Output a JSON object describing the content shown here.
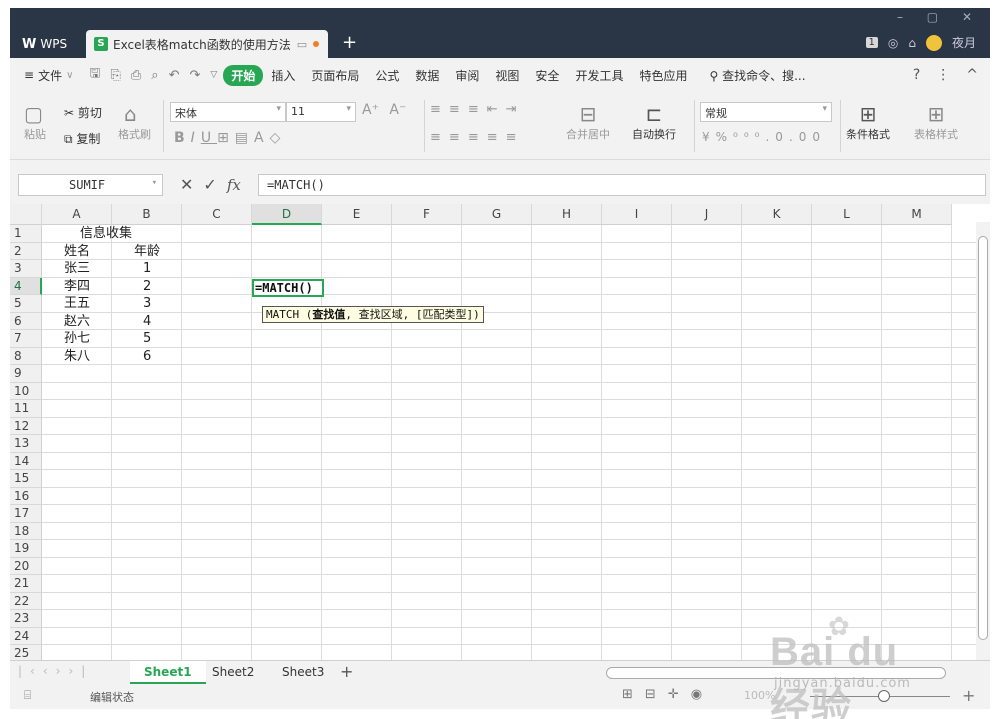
{
  "titlebar": {
    "wps_label": "WPS",
    "doc_tab": "Excel表格match函数的使用方法",
    "new_tab": "+",
    "win_min": "–",
    "win_max": "▢",
    "win_close": "✕",
    "badge": "1",
    "user": "夜月"
  },
  "menubar": {
    "file": "文件",
    "items": [
      "开始",
      "插入",
      "页面布局",
      "公式",
      "数据",
      "审阅",
      "视图",
      "安全",
      "开发工具",
      "特色应用"
    ],
    "search": "查找命令、搜...",
    "help": "?",
    "more": "⋮",
    "collapse": "^"
  },
  "ribbon": {
    "paste": "粘贴",
    "cut": "剪切",
    "copy": "复制",
    "format_painter": "格式刷",
    "font_name": "宋体",
    "font_size": "11",
    "merge_center": "合并居中",
    "wrap_text": "自动换行",
    "number_format": "常规",
    "conditional_format": "条件格式",
    "table_style": "表格样式"
  },
  "formulabar": {
    "namebox": "SUMIF",
    "fx": "fx",
    "formula": "=MATCH()"
  },
  "grid": {
    "columns": [
      "A",
      "B",
      "C",
      "D",
      "E",
      "F",
      "G",
      "H",
      "I",
      "J",
      "K",
      "L",
      "M"
    ],
    "selected_column": "D",
    "selected_row": "4",
    "rows": [
      "1",
      "2",
      "3",
      "4",
      "5",
      "6",
      "7",
      "8",
      "9",
      "10",
      "11",
      "12",
      "13",
      "14",
      "15",
      "16",
      "17",
      "18",
      "19",
      "20",
      "21",
      "22",
      "23",
      "24",
      "25"
    ],
    "title_cell": "信息收集",
    "header_name": "姓名",
    "header_age": "年龄",
    "names": [
      "张三",
      "李四",
      "王五",
      "赵六",
      "孙七",
      "朱八"
    ],
    "ages": [
      "1",
      "2",
      "3",
      "4",
      "5",
      "6"
    ],
    "active_cell_value": "=MATCH()",
    "tooltip_fn": "MATCH",
    "tooltip_arg1": "查找值",
    "tooltip_rest": ", 查找区域, [匹配类型])"
  },
  "sheets": {
    "tabs": [
      "Sheet1",
      "Sheet2",
      "Sheet3"
    ],
    "active": "Sheet1",
    "add": "+"
  },
  "statusbar": {
    "text": "编辑状态",
    "zoom": "100%",
    "zoom_plus": "+"
  },
  "watermark": {
    "brand": "Bai du 经验",
    "url": "jingyan.baidu.com"
  },
  "colors": {
    "accent": "#27a754",
    "titlebar": "#2a3545",
    "tooltip_bg": "#fffde1"
  }
}
